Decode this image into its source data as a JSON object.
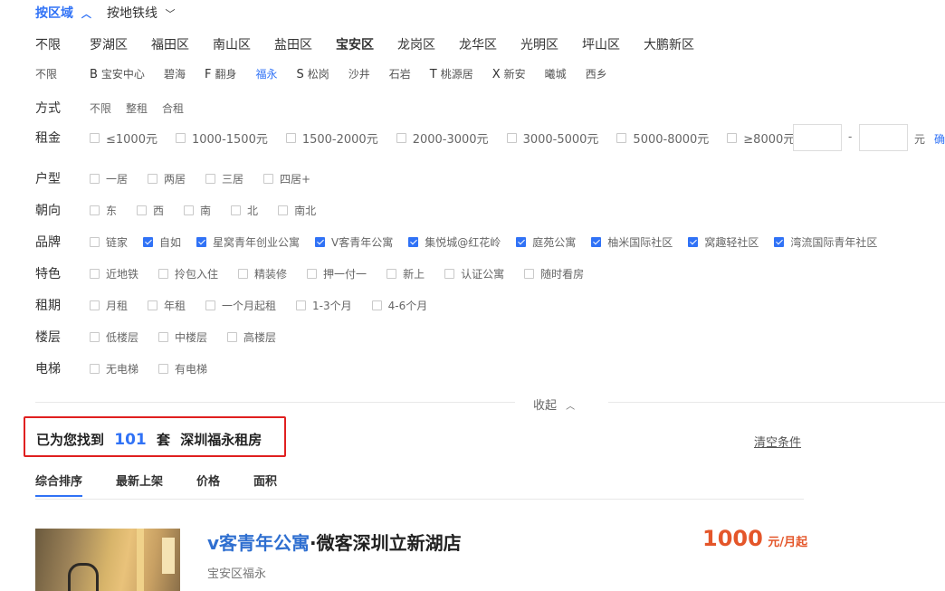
{
  "top_tabs": {
    "area": "按区域",
    "subway": "按地铁线"
  },
  "districts": [
    "不限",
    "罗湖区",
    "福田区",
    "南山区",
    "盐田区",
    "宝安区",
    "龙岗区",
    "龙华区",
    "光明区",
    "坪山区",
    "大鹏新区"
  ],
  "selected_district": "宝安区",
  "subareas": [
    {
      "letter": "",
      "name": "不限"
    },
    {
      "letter": "B",
      "name": "宝安中心"
    },
    {
      "letter": "",
      "name": "碧海"
    },
    {
      "letter": "F",
      "name": "翻身"
    },
    {
      "letter": "",
      "name": "福永"
    },
    {
      "letter": "S",
      "name": "松岗"
    },
    {
      "letter": "",
      "name": "沙井"
    },
    {
      "letter": "",
      "name": "石岩"
    },
    {
      "letter": "T",
      "name": "桃源居"
    },
    {
      "letter": "X",
      "name": "新安"
    },
    {
      "letter": "",
      "name": "曦城"
    },
    {
      "letter": "",
      "name": "西乡"
    }
  ],
  "selected_subarea": "福永",
  "mode": {
    "label": "方式",
    "options": [
      "不限",
      "整租",
      "合租"
    ]
  },
  "rent": {
    "label": "租金",
    "options": [
      "≤1000元",
      "1000-1500元",
      "1500-2000元",
      "2000-3000元",
      "3000-5000元",
      "5000-8000元",
      "≥8000元"
    ],
    "dash": "-",
    "unit": "元",
    "confirm": "确"
  },
  "filters": [
    {
      "label": "户型",
      "options": [
        {
          "t": "一居",
          "c": false
        },
        {
          "t": "两居",
          "c": false
        },
        {
          "t": "三居",
          "c": false
        },
        {
          "t": "四居+",
          "c": false
        }
      ]
    },
    {
      "label": "朝向",
      "options": [
        {
          "t": "东",
          "c": false
        },
        {
          "t": "西",
          "c": false
        },
        {
          "t": "南",
          "c": false
        },
        {
          "t": "北",
          "c": false
        },
        {
          "t": "南北",
          "c": false
        }
      ]
    },
    {
      "label": "品牌",
      "options": [
        {
          "t": "链家",
          "c": false
        },
        {
          "t": "自如",
          "c": true
        },
        {
          "t": "星窝青年创业公寓",
          "c": true
        },
        {
          "t": "V客青年公寓",
          "c": true
        },
        {
          "t": "集悦城@红花岭",
          "c": true
        },
        {
          "t": "庭苑公寓",
          "c": true
        },
        {
          "t": "柚米国际社区",
          "c": true
        },
        {
          "t": "窝趣轻社区",
          "c": true
        },
        {
          "t": "湾流国际青年社区",
          "c": true
        }
      ]
    },
    {
      "label": "特色",
      "options": [
        {
          "t": "近地铁",
          "c": false
        },
        {
          "t": "拎包入住",
          "c": false
        },
        {
          "t": "精装修",
          "c": false
        },
        {
          "t": "押一付一",
          "c": false
        },
        {
          "t": "新上",
          "c": false
        },
        {
          "t": "认证公寓",
          "c": false
        },
        {
          "t": "随时看房",
          "c": false
        }
      ]
    },
    {
      "label": "租期",
      "options": [
        {
          "t": "月租",
          "c": false
        },
        {
          "t": "年租",
          "c": false
        },
        {
          "t": "一个月起租",
          "c": false
        },
        {
          "t": "1-3个月",
          "c": false
        },
        {
          "t": "4-6个月",
          "c": false
        }
      ]
    },
    {
      "label": "楼层",
      "options": [
        {
          "t": "低楼层",
          "c": false
        },
        {
          "t": "中楼层",
          "c": false
        },
        {
          "t": "高楼层",
          "c": false
        }
      ]
    },
    {
      "label": "电梯",
      "options": [
        {
          "t": "无电梯",
          "c": false
        },
        {
          "t": "有电梯",
          "c": false
        }
      ]
    }
  ],
  "collapse": "收起",
  "result": {
    "prefix": "已为您找到",
    "count": "101",
    "unit": "套",
    "suffix": "深圳福永租房"
  },
  "clear": "清空条件",
  "sort_tabs": [
    "综合排序",
    "最新上架",
    "价格",
    "面积"
  ],
  "listing": {
    "brand": "v客青年公寓",
    "title": "·微客深圳立新湖店",
    "location": "宝安区福永",
    "price": "1000",
    "price_unit": "元/月起"
  }
}
